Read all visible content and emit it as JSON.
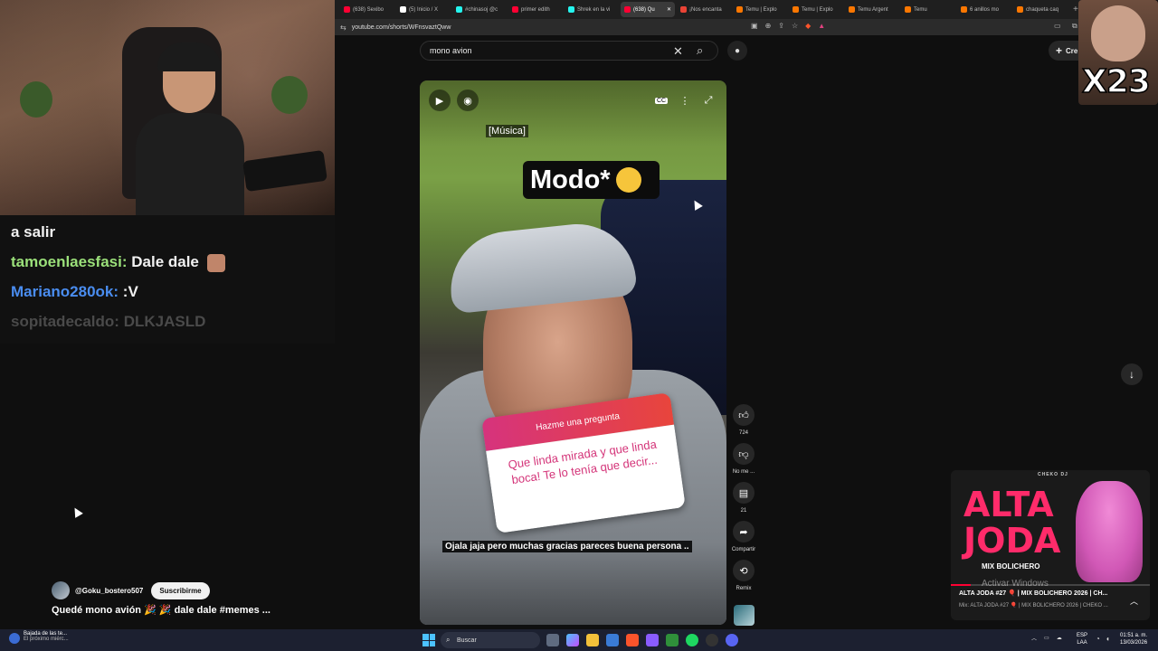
{
  "chat": {
    "lines": [
      {
        "user": "",
        "text": "a salir"
      },
      {
        "user": "tamoenlaesfasi:",
        "text": "Dale dale"
      },
      {
        "user": "Mariano280ok:",
        "text": ":V"
      },
      {
        "user": "sopitadecaldo:",
        "text": "DLKJASLD"
      }
    ]
  },
  "browser": {
    "tabs": [
      {
        "label": "(638) Sexibo",
        "color": "#ff0033"
      },
      {
        "label": "(5) Inicio / X",
        "color": "#ffffff"
      },
      {
        "label": "#chinasoj @c",
        "color": "#25f4ee"
      },
      {
        "label": "primer edith",
        "color": "#ff0033"
      },
      {
        "label": "Shrek en la vi",
        "color": "#25f4ee"
      },
      {
        "label": "(638) Qu",
        "color": "#ff0033"
      },
      {
        "label": "¡Nos encanta",
        "color": "#ea4335"
      },
      {
        "label": "Temu | Explo",
        "color": "#fb7701"
      },
      {
        "label": "Temu | Explo",
        "color": "#fb7701"
      },
      {
        "label": "Temu Argent",
        "color": "#fb7701"
      },
      {
        "label": "Temu",
        "color": "#fb7701"
      },
      {
        "label": "6 anillos mo",
        "color": "#fb7701"
      },
      {
        "label": "chaqueta caq",
        "color": "#fb7701"
      }
    ],
    "url": "youtube.com/shorts/WFnsvaztQww"
  },
  "youtube": {
    "search_value": "mono avion",
    "create_label": "Cre",
    "video": {
      "tag_musica": "[Música]",
      "modo_text": "Modo*",
      "question_header": "Hazme una pregunta",
      "question_body": "Que linda mirada y que linda boca! Te lo tenía que decir...",
      "caption": "Ojala jaja pero muchas gracias pareces buena persona .."
    },
    "actions": {
      "likes": "724",
      "dislike_label": "No me ...",
      "comments": "21",
      "share_label": "Compartir",
      "remix_label": "Remix"
    },
    "channel": "@Goku_bostero507",
    "subscribe_label": "Suscribirme",
    "title": "Quedé mono avión 🎉 🎉 dale dale #memes ..."
  },
  "meme_overlay": {
    "text": "X23"
  },
  "music_widget": {
    "small_text": "CHEKO DJ",
    "art_title": "ALTA JODA",
    "art_sub": "MIX BOLICHERO",
    "title": "ALTA JODA #27 🎈 | MIX BOLICHERO 2026 | CH...",
    "subtitle": "Mix: ALTA JODA #27 🎈 | MIX BOLICHERO 2026 | CHEKO ...",
    "progress": 0.1
  },
  "watermark": "Activar Windows",
  "taskbar": {
    "notif_title": "Bajada de las te...",
    "notif_sub": "El próximo miérc...",
    "search_label": "Buscar",
    "lang_line1": "ESP",
    "lang_line2": "LAA",
    "time": "01:51 a. m.",
    "date": "13/03/2026"
  }
}
